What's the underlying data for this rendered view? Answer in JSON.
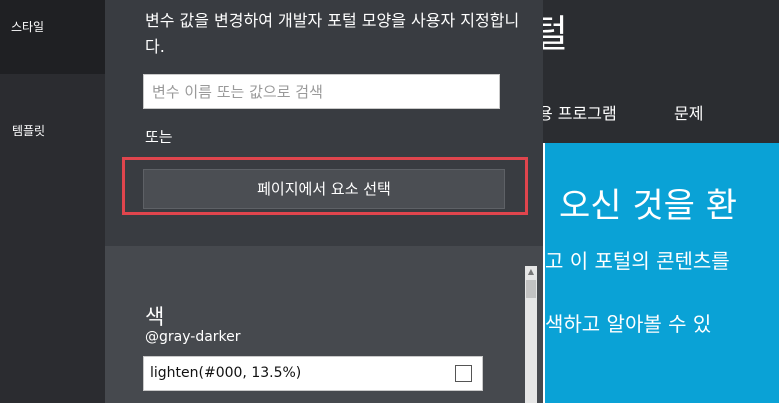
{
  "rail": {
    "items": [
      {
        "label": "스타일"
      },
      {
        "label": "템플릿"
      }
    ]
  },
  "panel": {
    "description": "변수 값을 변경하여 개발자 포털 모양을 사용자 지정합니다.",
    "search_placeholder": "변수 이름 또는 값으로 검색",
    "or_label": "또는",
    "pick_button": "페이지에서 요소 선택",
    "section_title": "색",
    "variable": {
      "name": "@gray-darker",
      "value": "lighten(#000, 13.5%)"
    }
  },
  "preview": {
    "title": "털",
    "nav_app": "용 프로그램",
    "nav_issues": "문제",
    "hero_line1": "오신 것을 환",
    "hero_line2": "고 이 포털의 콘텐츠를",
    "hero_line3": "색하고 알아볼 수 있"
  },
  "colors": {
    "highlight": "#e0454d",
    "hero_bg": "#0aa2d6",
    "panel_bg": "#393c41",
    "panel_bottom_bg": "#46494e"
  }
}
